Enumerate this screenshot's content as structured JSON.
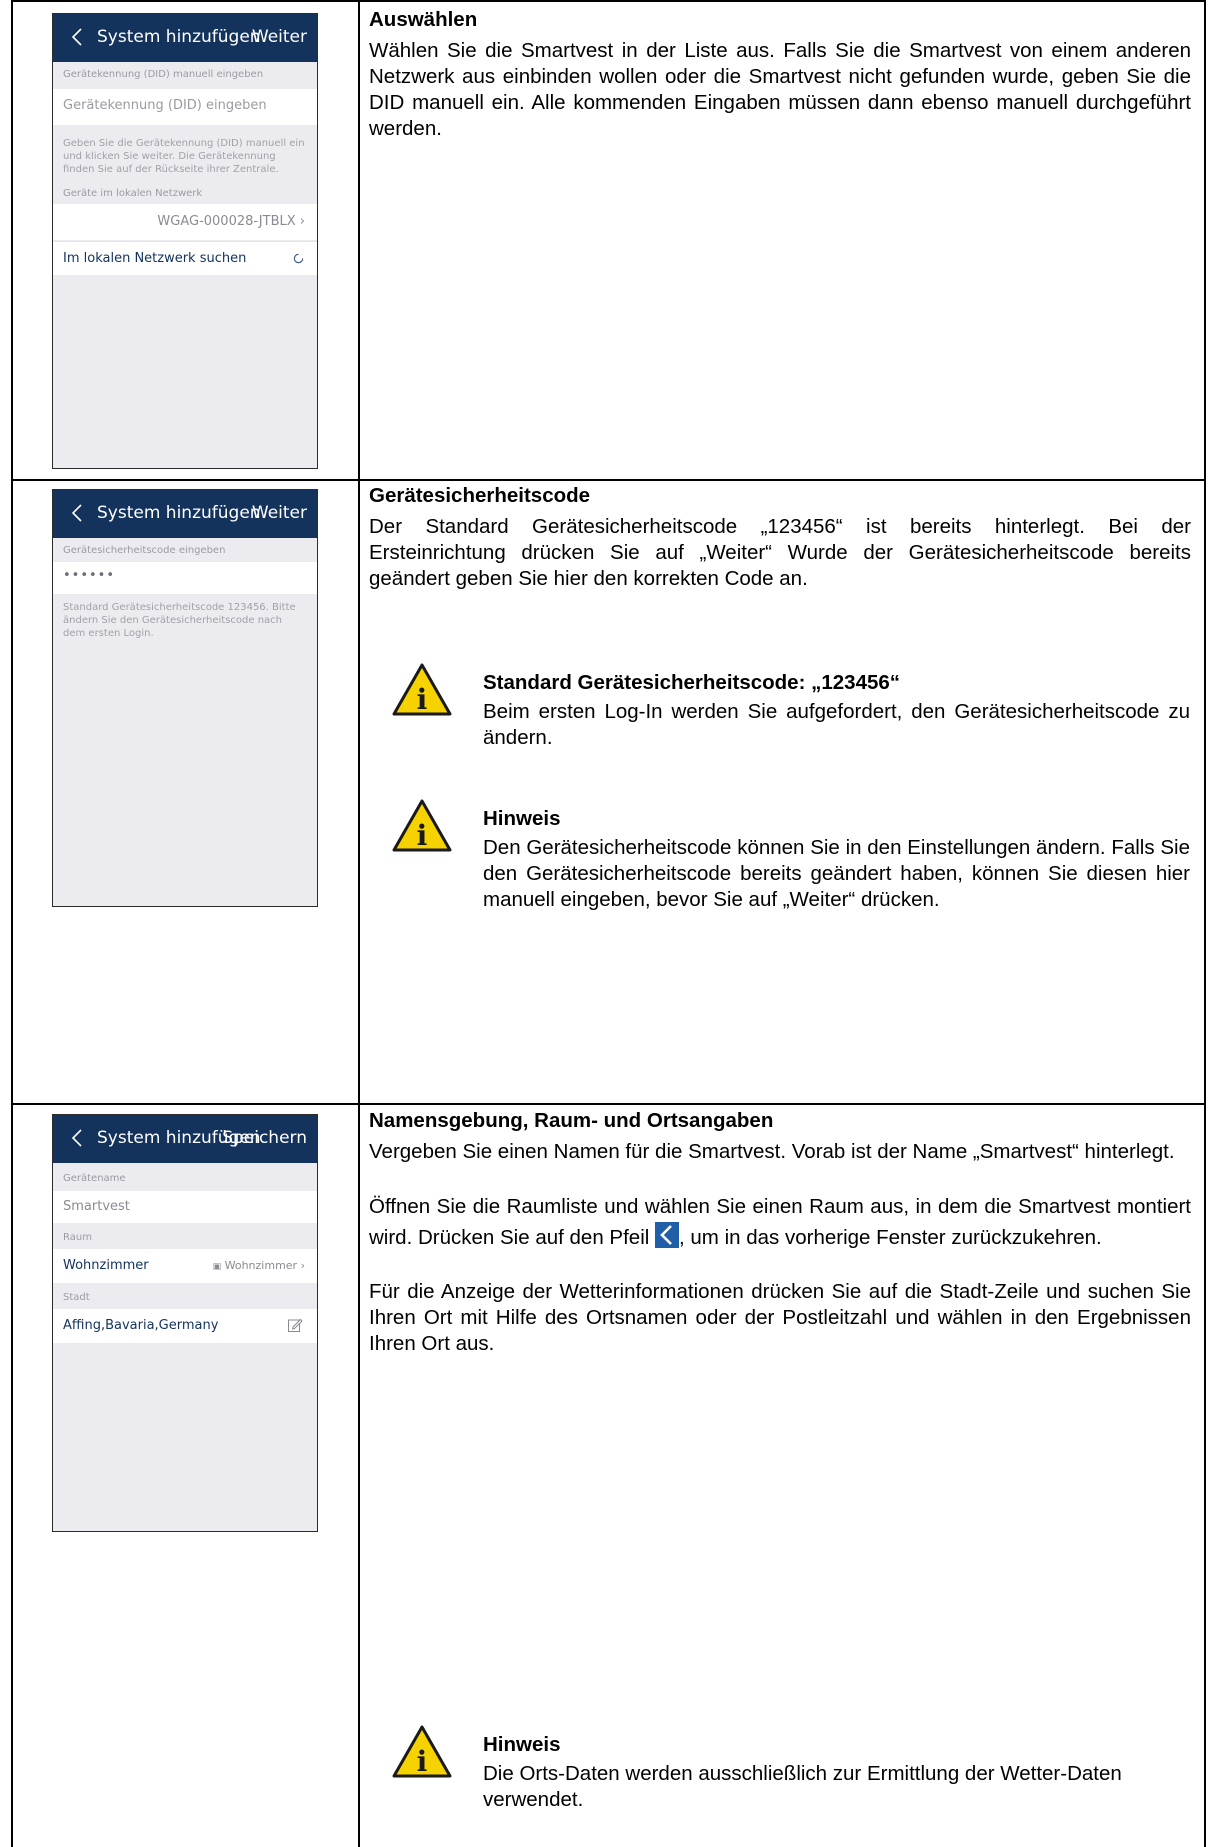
{
  "rows": [
    {
      "phone": {
        "nav": {
          "title": "System hinzufügen",
          "action": "Weiter",
          "back_icon": "chevron-left-icon"
        },
        "section1": "Gerätekennung (DID) manuell eingeben",
        "did_placeholder": "Gerätekennung (DID) eingeben",
        "hint": "Geben Sie die Gerätekennung (DID) manuell ein und klicken Sie weiter. Die Gerätekennung finden Sie auf der Rückseite ihrer Zentrale.",
        "section2": "Geräte im lokalen Netzwerk",
        "device": "WGAG-000028-JTBLX",
        "search_label": "Im lokalen Netzwerk suchen",
        "refresh_icon": "refresh-icon"
      },
      "heading": "Auswählen",
      "paragraphs": [
        "Wählen Sie die Smartvest in der Liste aus. Falls Sie die Smartvest von einem anderen Netzwerk aus einbinden wollen oder die Smartvest nicht gefunden wurde, geben Sie die DID manuell ein. Alle kommenden Eingaben müssen dann ebenso manuell durchgeführt werden."
      ]
    },
    {
      "phone": {
        "nav": {
          "title": "System hinzufügen",
          "action": "Weiter",
          "back_icon": "chevron-left-icon"
        },
        "section1": "Gerätesicherheitscode eingeben",
        "code_value": "••••••",
        "hint": "Standard Gerätesicherheitscode 123456. Bitte ändern Sie den Gerätesicherheitscode nach dem ersten Login."
      },
      "heading": "Gerätesicherheitscode",
      "paragraphs": [
        "Der Standard Gerätesicherheitscode „123456“ ist bereits hinterlegt. Bei der Ersteinrichtung drücken Sie auf „Weiter“ Wurde der Gerätesicherheitscode bereits geändert geben Sie hier den korrekten Code an."
      ],
      "notes": [
        {
          "icon": "info-warning-icon",
          "title": "Standard Gerätesicherheitscode: „123456“",
          "body": "Beim ersten Log-In werden Sie aufgefordert, den Gerätesicherheitscode zu ändern."
        },
        {
          "icon": "info-warning-icon",
          "title": "Hinweis",
          "body": "Den Gerätesicherheitscode können Sie in den Einstellungen ändern. Falls Sie den Gerätesicherheitscode bereits geändert haben, können Sie diesen hier manuell eingeben, bevor Sie auf „Weiter“ drücken."
        }
      ]
    },
    {
      "phone": {
        "nav": {
          "title": "System hinzufügen",
          "action": "Speichern",
          "back_icon": "chevron-left-icon"
        },
        "section_name": "Gerätename",
        "name_value": "Smartvest",
        "section_room": "Raum",
        "room_label": "Wohnzimmer",
        "room_value": "Wohnzimmer",
        "section_city": "Stadt",
        "city_value": "Affing,Bavaria,Germany",
        "edit_icon": "edit-icon"
      },
      "heading": "Namensgebung, Raum- und Ortsangaben",
      "paragraphs": [
        "Vergeben Sie einen Namen für die Smartvest. Vorab ist der Name „Smartvest“ hinterlegt.",
        "Öffnen Sie die Raumliste und wählen Sie einen Raum aus, in dem die Smartvest montiert wird. Drücken Sie auf den Pfeil",
        ", um in das vorherige Fenster zurückzukehren.",
        "Für die Anzeige der Wetterinformationen drücken Sie auf die Stadt-Zeile und suchen Sie Ihren Ort mit Hilfe des Ortsnamen oder der Postleitzahl und wählen in den Ergebnissen Ihren Ort aus."
      ],
      "notes": [
        {
          "icon": "info-warning-icon",
          "title": "Hinweis",
          "body": "Die Orts-Daten werden ausschließlich zur Ermittlung der Wetter-Daten verwendet."
        }
      ],
      "inline_icon": "back-arrow-icon"
    }
  ],
  "colors": {
    "nav": "#13325c",
    "phone_bg": "#ececf0",
    "warning_yellow": "#f5d200",
    "inline_arrow": "#1f5fa8"
  }
}
